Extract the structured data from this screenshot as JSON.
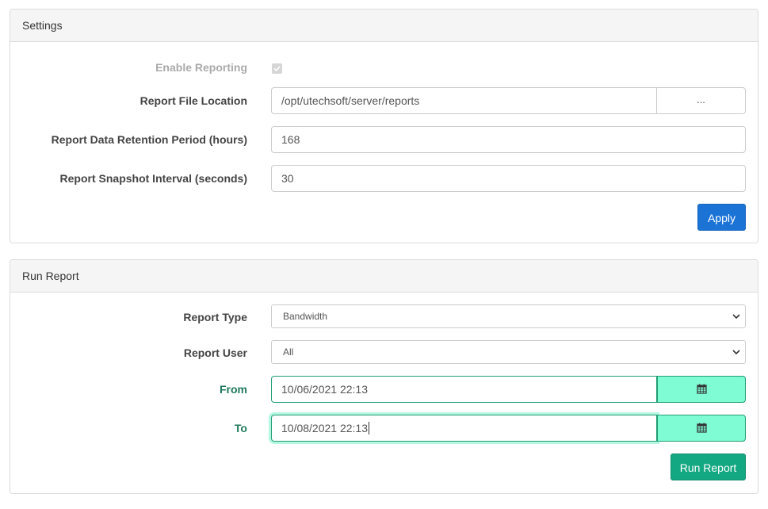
{
  "settings": {
    "title": "Settings",
    "enable_reporting": {
      "label": "Enable Reporting",
      "checked": true,
      "disabled": true
    },
    "file_location": {
      "label": "Report File Location",
      "value": "/opt/utechsoft/server/reports",
      "browse_label": "..."
    },
    "retention": {
      "label": "Report Data Retention Period (hours)",
      "value": "168"
    },
    "snapshot": {
      "label": "Report Snapshot Interval (seconds)",
      "value": "30"
    },
    "apply_label": "Apply"
  },
  "run_report": {
    "title": "Run Report",
    "report_type": {
      "label": "Report Type",
      "value": "Bandwidth"
    },
    "report_user": {
      "label": "Report User",
      "value": "All"
    },
    "from": {
      "label": "From",
      "value": "10/06/2021 22:13"
    },
    "to": {
      "label": "To",
      "value": "10/08/2021 22:13"
    },
    "run_label": "Run Report"
  },
  "icons": {
    "calendar": "calendar-icon",
    "dropdown": "chevron-down-icon",
    "check": "check-icon"
  },
  "colors": {
    "apply_button": "#1b73d6",
    "run_button": "#14a882",
    "valid_label": "#1f7a5a",
    "valid_addon": "#7ffcd4"
  }
}
